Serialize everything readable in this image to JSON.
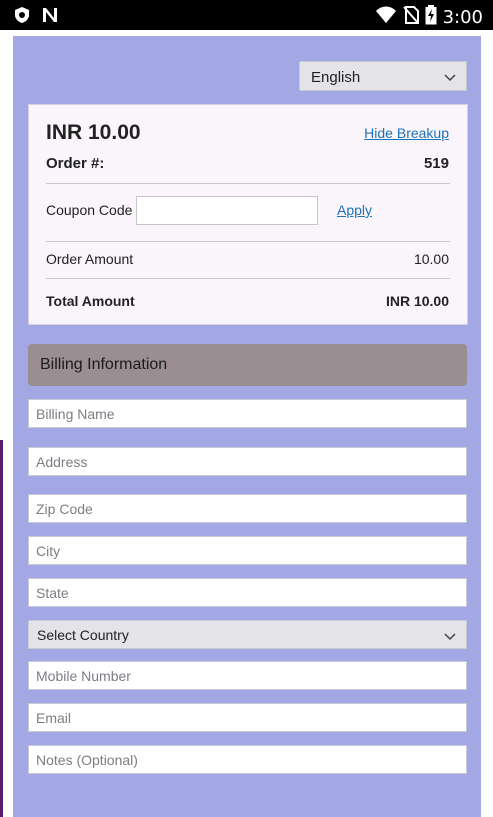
{
  "status_bar": {
    "time": "3:00",
    "left_icons": [
      "shield-app-icon",
      "n-app-icon"
    ],
    "right_icons": [
      "wifi-icon",
      "no-sim-icon",
      "battery-charging-icon"
    ]
  },
  "language": {
    "selected": "English"
  },
  "summary": {
    "amount": "INR 10.00",
    "hide_breakup_label": "Hide Breakup",
    "order_label": "Order #:",
    "order_number": "519",
    "coupon_label": "Coupon Code",
    "coupon_value": "",
    "apply_label": "Apply",
    "order_amount_label": "Order  Amount",
    "order_amount_value": "10.00",
    "total_label": "Total Amount",
    "total_value": "INR 10.00"
  },
  "billing": {
    "header": "Billing Information",
    "name_placeholder": "Billing Name",
    "address_placeholder": "Address",
    "zip_placeholder": "Zip Code",
    "city_placeholder": "City",
    "state_placeholder": "State",
    "country_selected": "Select Country",
    "mobile_placeholder": "Mobile Number",
    "email_placeholder": "Email",
    "notes_placeholder": "Notes (Optional)"
  },
  "colors": {
    "panel_bg": "#a3a8e5",
    "billing_header_bg": "#9a8e93",
    "link": "#1e72b8",
    "status_bar_bg": "#000000"
  }
}
